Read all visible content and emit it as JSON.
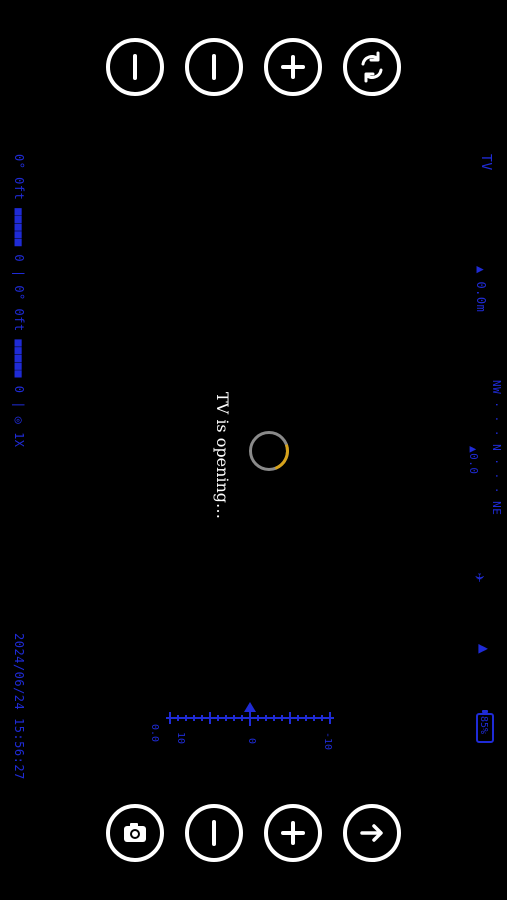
{
  "top_controls": [
    {
      "name": "left-control-button",
      "icon": "line-icon"
    },
    {
      "name": "right-control-button",
      "icon": "line-icon"
    },
    {
      "name": "add-button",
      "icon": "plus-icon"
    },
    {
      "name": "refresh-button",
      "icon": "refresh-icon"
    }
  ],
  "bottom_controls": [
    {
      "name": "camera-button",
      "icon": "camera-icon"
    },
    {
      "name": "line-button",
      "icon": "line-icon"
    },
    {
      "name": "add-button-2",
      "icon": "plus-icon"
    },
    {
      "name": "next-button",
      "icon": "arrow-right-icon"
    }
  ],
  "hud": {
    "left_top": "0° 0ft ■■■■■ 0 | 0° 0ft ■■■■■ 0 | ◎ 1X",
    "left_bottom": "2024/06/24 15:56:27",
    "right_tv": "TV",
    "right_alt": "▲ 0.0m",
    "right_compass": "NW · · · N · · · NE",
    "right_compass_val": "▲0.0",
    "right_plane": "✈",
    "right_signal": "▲",
    "battery": "85%"
  },
  "ruler": {
    "labels": [
      "0.0",
      "10",
      "0",
      "-10"
    ]
  },
  "status": {
    "text": "TV is opening…"
  },
  "colors": {
    "hud_blue": "#1f2bd6",
    "button_white": "#ffffff",
    "loader_gray": "#8a8a8a",
    "loader_accent": "#d6a21a"
  }
}
